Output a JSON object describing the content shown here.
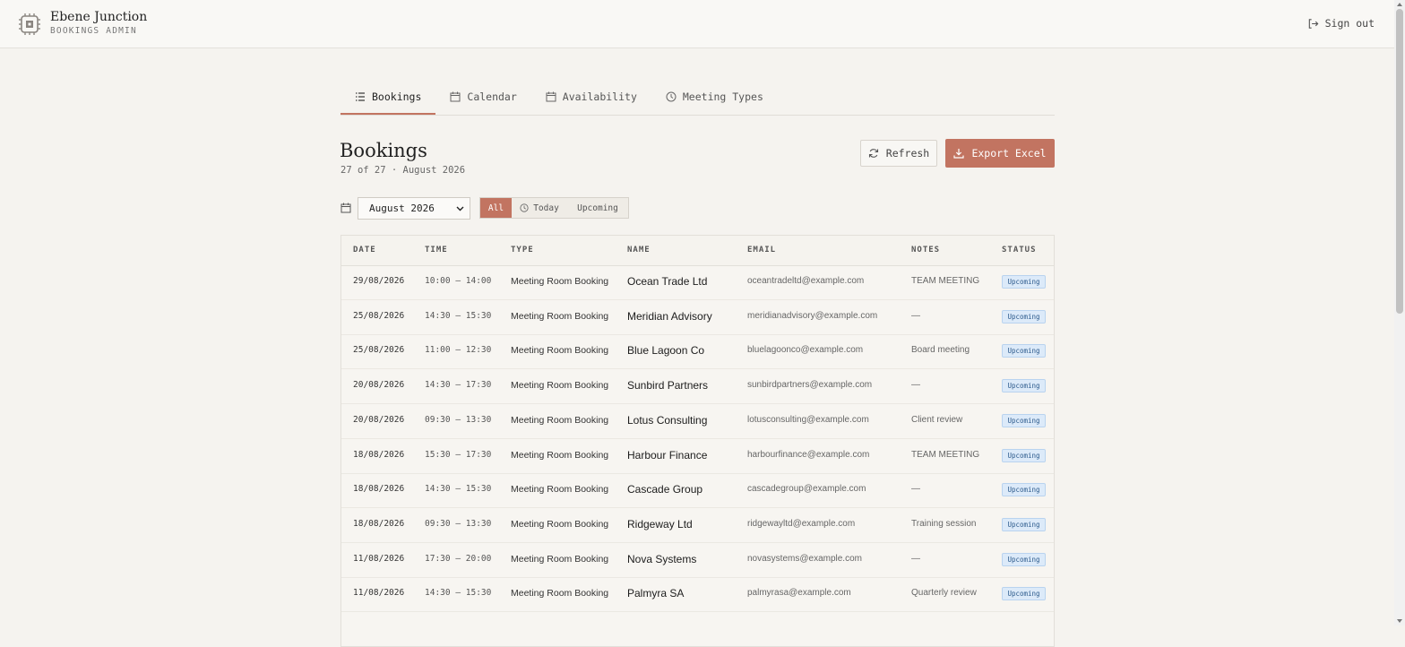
{
  "header": {
    "brand_name": "Ebene Junction",
    "brand_sub": "BOOKINGS ADMIN",
    "signout_label": "Sign out"
  },
  "tabs": [
    {
      "label": "Bookings",
      "icon": "list-icon",
      "active": true
    },
    {
      "label": "Calendar",
      "icon": "calendar-icon",
      "active": false
    },
    {
      "label": "Availability",
      "icon": "calendar-icon",
      "active": false
    },
    {
      "label": "Meeting Types",
      "icon": "clock-icon",
      "active": false
    }
  ],
  "page": {
    "title": "Bookings",
    "subtitle": "27 of 27 · August 2026",
    "refresh_label": "Refresh",
    "export_label": "Export Excel"
  },
  "filters": {
    "month_value": "August 2026",
    "segments": [
      "All",
      "Today",
      "Upcoming"
    ],
    "active_segment": "All"
  },
  "table": {
    "columns": [
      "DATE",
      "TIME",
      "TYPE",
      "NAME",
      "EMAIL",
      "NOTES",
      "STATUS"
    ],
    "rows": [
      {
        "date": "29/08/2026",
        "time": "10:00 – 14:00",
        "type": "Meeting Room Booking",
        "name": "Ocean Trade Ltd",
        "email": "oceantradeltd@example.com",
        "notes": "TEAM MEETING",
        "status": "Upcoming"
      },
      {
        "date": "25/08/2026",
        "time": "14:30 – 15:30",
        "type": "Meeting Room Booking",
        "name": "Meridian Advisory",
        "email": "meridianadvisory@example.com",
        "notes": "—",
        "status": "Upcoming"
      },
      {
        "date": "25/08/2026",
        "time": "11:00 – 12:30",
        "type": "Meeting Room Booking",
        "name": "Blue Lagoon Co",
        "email": "bluelagoonco@example.com",
        "notes": "Board meeting",
        "status": "Upcoming"
      },
      {
        "date": "20/08/2026",
        "time": "14:30 – 17:30",
        "type": "Meeting Room Booking",
        "name": "Sunbird Partners",
        "email": "sunbirdpartners@example.com",
        "notes": "—",
        "status": "Upcoming"
      },
      {
        "date": "20/08/2026",
        "time": "09:30 – 13:30",
        "type": "Meeting Room Booking",
        "name": "Lotus Consulting",
        "email": "lotusconsulting@example.com",
        "notes": "Client review",
        "status": "Upcoming"
      },
      {
        "date": "18/08/2026",
        "time": "15:30 – 17:30",
        "type": "Meeting Room Booking",
        "name": "Harbour Finance",
        "email": "harbourfinance@example.com",
        "notes": "TEAM MEETING",
        "status": "Upcoming"
      },
      {
        "date": "18/08/2026",
        "time": "14:30 – 15:30",
        "type": "Meeting Room Booking",
        "name": "Cascade Group",
        "email": "cascadegroup@example.com",
        "notes": "—",
        "status": "Upcoming"
      },
      {
        "date": "18/08/2026",
        "time": "09:30 – 13:30",
        "type": "Meeting Room Booking",
        "name": "Ridgeway Ltd",
        "email": "ridgewayltd@example.com",
        "notes": "Training session",
        "status": "Upcoming"
      },
      {
        "date": "11/08/2026",
        "time": "17:30 – 20:00",
        "type": "Meeting Room Booking",
        "name": "Nova Systems",
        "email": "novasystems@example.com",
        "notes": "—",
        "status": "Upcoming"
      },
      {
        "date": "11/08/2026",
        "time": "14:30 – 15:30",
        "type": "Meeting Room Booking",
        "name": "Palmyra SA",
        "email": "palmyrasa@example.com",
        "notes": "Quarterly review",
        "status": "Upcoming"
      }
    ]
  },
  "colors": {
    "accent": "#c27461",
    "badge_bg": "#dceaf9",
    "badge_text": "#2c5a8c",
    "page_bg": "#f5f3ef"
  }
}
